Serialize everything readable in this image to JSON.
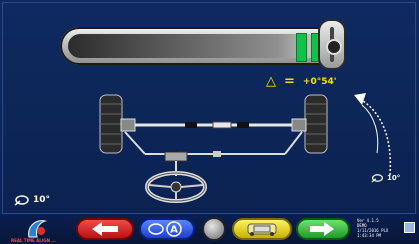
{
  "measurement": {
    "delta_symbol": "△",
    "equals": "=",
    "value": "+0°54'"
  },
  "angles": {
    "left_readout": "10°",
    "right_readout": "10°"
  },
  "scale": {
    "lit_segments": 2
  },
  "taskbar": {
    "info_lines": [
      "Ver 4.1.5",
      "DEMO",
      "1/11/2016",
      "PLX",
      "1:43:34 PM"
    ],
    "brand_text": "REAL TIME ALIGN ..."
  },
  "colors": {
    "accent": "#f6e000",
    "ok": "#10c24a",
    "back": "#d62020",
    "next": "#27b53b",
    "car": "#e6cf00"
  }
}
